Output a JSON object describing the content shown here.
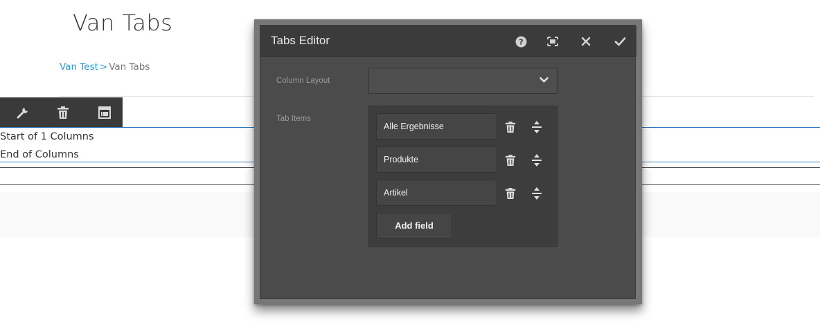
{
  "page": {
    "title": "Van Tabs",
    "breadcrumb": {
      "parent": "Van Test",
      "separator": ">",
      "current": "Van Tabs"
    }
  },
  "toolbar": {
    "buttons": [
      {
        "icon": "wrench-icon"
      },
      {
        "icon": "trash-icon"
      },
      {
        "icon": "parent-component-icon"
      }
    ]
  },
  "columns": {
    "start_label": "Start of 1 Columns",
    "end_label": "End of Columns"
  },
  "dialog": {
    "title": "Tabs Editor",
    "header_buttons": [
      {
        "icon": "help-icon"
      },
      {
        "icon": "fullscreen-icon"
      },
      {
        "icon": "close-icon"
      },
      {
        "icon": "check-icon"
      }
    ],
    "column_layout": {
      "label": "Column Layout",
      "value": ""
    },
    "tab_items": {
      "label": "Tab Items",
      "items": [
        "Alle Ergebnisse",
        "Produkte",
        "Artikel"
      ],
      "add_label": "Add field"
    }
  },
  "colors": {
    "accent": "#2a9fd6",
    "line_blue": "#2d7bc0",
    "dialog_bg": "#4b4b4b",
    "dialog_header": "#3b3b3b",
    "toolbar_bg": "#3a3a3a"
  }
}
